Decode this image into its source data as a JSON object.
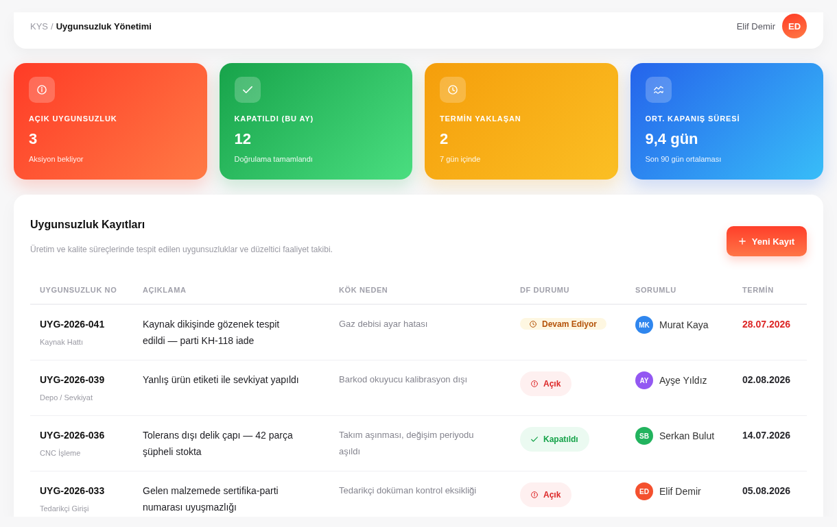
{
  "header": {
    "breadcrumb": {
      "parent": "KYS",
      "separator": "/",
      "current": "Uygunsuzluk Yönetimi"
    },
    "user": {
      "name": "Elif Demir",
      "initials": "ED"
    }
  },
  "stats": [
    {
      "kind": "open",
      "label": "AÇIK UYGUNSUZLUK",
      "value": "3",
      "note": "Aksiyon bekliyor"
    },
    {
      "kind": "closed",
      "label": "KAPATILDI (BU AY)",
      "value": "12",
      "note": "Doğrulama tamamlandı"
    },
    {
      "kind": "due",
      "label": "TERMİN YAKLAŞAN",
      "value": "2",
      "note": "7 gün içinde"
    },
    {
      "kind": "average",
      "label": "ORT. KAPANIŞ SÜRESİ",
      "value": "9,4 gün",
      "note": "Son 90 gün ortalaması"
    }
  ],
  "records": {
    "title": "Uygunsuzluk Kayıtları",
    "subtitle": "Üretim ve kalite süreçlerinde tespit edilen uygunsuzluklar ve düzeltici faaliyet takibi.",
    "new_button": "Yeni Kayıt",
    "columns": [
      "UYGUNSUZLUK NO",
      "AÇIKLAMA",
      "KÖK NEDEN",
      "DF DURUMU",
      "SORUMLU",
      "TERMİN"
    ],
    "rows": [
      {
        "id": "UYG-2026-041",
        "area": "Kaynak Hattı",
        "description": "Kaynak dikişinde gözenek tespit edildi — parti KH-118 iade",
        "root_cause": "Gaz debisi ayar hatası",
        "status": {
          "kind": "in_progress",
          "label": "Devam Ediyor"
        },
        "owner": {
          "initials": "MK",
          "name": "Murat Kaya",
          "color": "#2f86ee"
        },
        "due": "28.07.2026",
        "overdue": true
      },
      {
        "id": "UYG-2026-039",
        "area": "Depo / Sevkiyat",
        "description": "Yanlış ürün etiketi ile sevkiyat yapıldı",
        "root_cause": "Barkod okuyucu kalibrasyon dışı",
        "status": {
          "kind": "open",
          "label": "Açık"
        },
        "owner": {
          "initials": "AY",
          "name": "Ayşe Yıldız",
          "color": "#9358f2"
        },
        "due": "02.08.2026",
        "overdue": false
      },
      {
        "id": "UYG-2026-036",
        "area": "CNC İşleme",
        "description": "Tolerans dışı delik çapı — 42 parça şüpheli stokta",
        "root_cause": "Takım aşınması, değişim periyodu aşıldı",
        "status": {
          "kind": "closed",
          "label": "Kapatıldı"
        },
        "owner": {
          "initials": "SB",
          "name": "Serkan Bulut",
          "color": "#22b35e"
        },
        "due": "14.07.2026",
        "overdue": false
      },
      {
        "id": "UYG-2026-033",
        "area": "Tedarikçi Girişi",
        "description": "Gelen malzemede sertifika-parti numarası uyuşmazlığı",
        "root_cause": "Tedarikçi doküman kontrol eksikliği",
        "status": {
          "kind": "open",
          "label": "Açık"
        },
        "owner": {
          "initials": "ED",
          "name": "Elif Demir",
          "color": "#f4502e"
        },
        "due": "05.08.2026",
        "overdue": false
      }
    ]
  }
}
